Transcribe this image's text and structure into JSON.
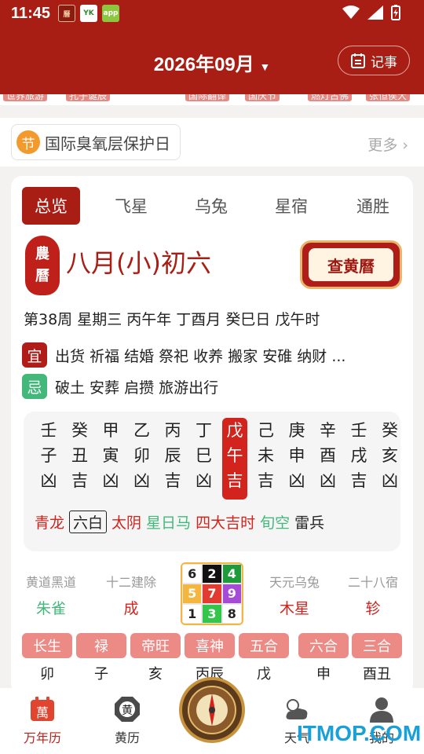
{
  "status": {
    "time": "11:45"
  },
  "header": {
    "month_title": "2026年09月",
    "memo_label": "记事"
  },
  "strip_items": [
    "世界旅游",
    "孔子诞辰",
    "国际翻译",
    "国庆节",
    "燃灯古佛",
    "张恒侯大"
  ],
  "festival": {
    "badge": "节",
    "name": "国际臭氧层保护日",
    "more": "更多"
  },
  "tabs": [
    "总览",
    "飞星",
    "乌兔",
    "星宿",
    "通胜"
  ],
  "lunar": {
    "seal_top": "農",
    "seal_bottom": "曆",
    "date": "八月(小)初六",
    "check_button": "查黄曆"
  },
  "dateline": "第38周 星期三 丙午年 丁酉月 癸巳日 戊午时",
  "yi": {
    "badge": "宜",
    "items": "出货 祈福 结婚 祭祀 收养 搬家 安碓 纳财 ...",
    "color": "#b01c18"
  },
  "ji": {
    "badge": "忌",
    "items": "破土 安葬 启攒 旅游出行",
    "color": "#43b87b"
  },
  "hours": [
    {
      "gan": "壬",
      "zhi": "子",
      "luck": "凶"
    },
    {
      "gan": "癸",
      "zhi": "丑",
      "luck": "吉"
    },
    {
      "gan": "甲",
      "zhi": "寅",
      "luck": "凶"
    },
    {
      "gan": "乙",
      "zhi": "卯",
      "luck": "凶"
    },
    {
      "gan": "丙",
      "zhi": "辰",
      "luck": "吉"
    },
    {
      "gan": "丁",
      "zhi": "巳",
      "luck": "凶"
    },
    {
      "gan": "戊",
      "zhi": "午",
      "luck": "吉"
    },
    {
      "gan": "己",
      "zhi": "未",
      "luck": "吉"
    },
    {
      "gan": "庚",
      "zhi": "申",
      "luck": "凶"
    },
    {
      "gan": "辛",
      "zhi": "酉",
      "luck": "凶"
    },
    {
      "gan": "壬",
      "zhi": "戌",
      "luck": "吉"
    },
    {
      "gan": "癸",
      "zhi": "亥",
      "luck": "凶"
    }
  ],
  "gods": [
    {
      "text": "青龙",
      "color": "#d2231c"
    },
    {
      "text": "六白",
      "color": "#222"
    },
    {
      "text": "太阴",
      "color": "#d2231c"
    },
    {
      "text": "星日马",
      "color": "#43b87b"
    },
    {
      "text": "四大吉时",
      "color": "#d2231c"
    },
    {
      "text": "旬空",
      "color": "#43b87b"
    },
    {
      "text": "雷兵",
      "color": "#222"
    }
  ],
  "info": [
    {
      "label": "黄道黑道",
      "value": "朱雀",
      "color": "#43b87b"
    },
    {
      "label": "十二建除",
      "value": "成",
      "color": "#d2231c"
    },
    {
      "label": "天元乌兔",
      "value": "木星",
      "color": "#d2231c"
    },
    {
      "label": "二十八宿",
      "value": "轸",
      "color": "#d2231c"
    }
  ],
  "nine_star": [
    {
      "n": "6",
      "bg": "#ffffff",
      "fg": "#222"
    },
    {
      "n": "2",
      "bg": "#111111",
      "fg": "#fff"
    },
    {
      "n": "4",
      "bg": "#1f9a3a",
      "fg": "#fff"
    },
    {
      "n": "5",
      "bg": "#f4b63e",
      "fg": "#fff"
    },
    {
      "n": "7",
      "bg": "#e23b32",
      "fg": "#fff"
    },
    {
      "n": "9",
      "bg": "#a64bd6",
      "fg": "#fff"
    },
    {
      "n": "1",
      "bg": "#ffffff",
      "fg": "#222"
    },
    {
      "n": "3",
      "bg": "#34c64b",
      "fg": "#fff"
    },
    {
      "n": "8",
      "bg": "#ffffff",
      "fg": "#222"
    }
  ],
  "bottom_tags": [
    {
      "tag": "长生",
      "value": "卯"
    },
    {
      "tag": "禄",
      "value": "子"
    },
    {
      "tag": "帝旺",
      "value": "亥"
    },
    {
      "tag": "喜神",
      "value": "丙辰"
    },
    {
      "tag": "五合",
      "value": "戊"
    },
    {
      "tag": "六合",
      "value": "申"
    },
    {
      "tag": "三合",
      "value": "酉丑"
    }
  ],
  "nav": [
    {
      "label": "万年历",
      "icon": "calendar-icon",
      "active": true
    },
    {
      "label": "黄历",
      "icon": "bagua-icon",
      "active": false
    },
    {
      "label": "天气",
      "icon": "weather-icon",
      "active": false
    },
    {
      "label": "我的",
      "icon": "user-icon",
      "active": false
    }
  ],
  "watermark": "ITMOP.COM",
  "colors": {
    "brand": "#a91e14",
    "accent_green": "#43b87b",
    "tag_pink": "#ec8a85"
  }
}
